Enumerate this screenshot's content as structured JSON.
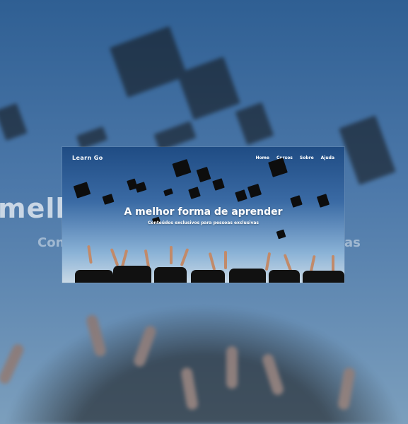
{
  "app": {
    "logo": "Learn Go"
  },
  "nav": {
    "items": [
      "Home",
      "Cursos",
      "Sobre",
      "Ajuda"
    ]
  },
  "hero": {
    "title": "A melhor forma de aprender",
    "subtitle": "Conteúdos exclusivos para pessoas exclusivas"
  },
  "background": {
    "large_text": "melh                            rend",
    "sub_left": "Con",
    "sub_right": "as",
    "colors": {
      "sky_top": "#2f5f93",
      "sky_bottom": "#7c9fbd",
      "cap": "#111111",
      "text": "#ffffff"
    }
  }
}
